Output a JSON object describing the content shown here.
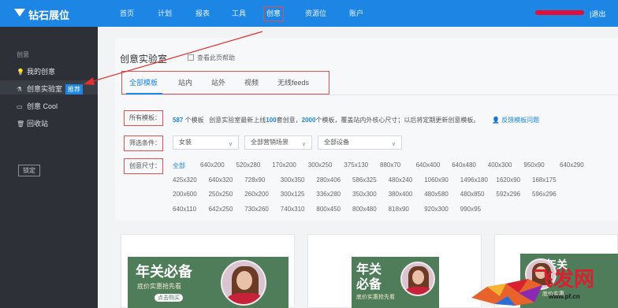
{
  "app": {
    "logo": "钻石展位"
  },
  "topnav": [
    "首页",
    "计划",
    "报表",
    "工具",
    "创意",
    "资源位",
    "账户"
  ],
  "topnav_active": "创意",
  "header": {
    "logout": "退出",
    "separator": "|"
  },
  "sidebar": {
    "section": "创意",
    "items": [
      {
        "label": "我的创意",
        "icon": "bulb-icon"
      },
      {
        "label": "创意实验室",
        "icon": "flask-icon",
        "badge": "推荐"
      },
      {
        "label": "创意 Cool",
        "icon": "briefcase-icon"
      },
      {
        "label": "回收站",
        "icon": "trash-icon"
      }
    ],
    "lock_button": "锁定"
  },
  "page": {
    "title": "创意实验室",
    "help": "查看此页帮助",
    "tabs": [
      "全部模板",
      "站内",
      "站外",
      "视频",
      "无线feeds"
    ],
    "active_tab": "全部模板"
  },
  "filters": {
    "all_templates_label": "所有模板：",
    "template_count": "587",
    "template_unit": "个模板",
    "desc_pre": "创意实验室最新上线",
    "desc_num1": "100",
    "desc_mid": "套创意，",
    "desc_num2": "2000",
    "desc_post": "个模板，覆盖站内外核心尺寸；以后将定期更新创意模板。",
    "feedback": "反馈模板问题",
    "condition_label": "筛选条件：",
    "select_1": "女装",
    "select_2": "全部营销场景",
    "select_3": "全部设备",
    "size_label": "创意尺寸：",
    "sizes_row1": [
      "全部",
      "640x200",
      "520x280",
      "170x200",
      "300x250",
      "375x130",
      "880x70",
      "640x400",
      "640x480",
      "400x300",
      "950x90",
      "640x290"
    ],
    "sizes_row2": [
      "425x320",
      "640x320",
      "728x90",
      "300x350",
      "280x406",
      "586x325",
      "480x240",
      "1060x90",
      "1496x180",
      "1620x90",
      "168x175"
    ],
    "sizes_row3": [
      "200x600",
      "250x250",
      "260x200",
      "300x125",
      "336x280",
      "350x300",
      "380x400",
      "480x580",
      "480x850",
      "592x296",
      "596x296"
    ],
    "sizes_row4": [
      "640x110",
      "642x250",
      "730x260",
      "740x310",
      "800x450",
      "800x480",
      "818x90",
      "920x300",
      "990x95"
    ]
  },
  "cards": [
    {
      "title": "年关必备",
      "sub": "底价实惠抢先看",
      "tag": "点击购买"
    },
    {
      "title_1": "年关",
      "title_2": "必备",
      "sub": "底价实惠抢先看"
    },
    {
      "title": "年关",
      "sub": "底价实惠"
    }
  ],
  "watermark": {
    "text": "飞发网",
    "url": "www.pf.cn"
  },
  "colors": {
    "topbar": "#1d86e4",
    "sidebar": "#2d3037",
    "annotation": "#e05050",
    "accent": "#1d86e4"
  }
}
